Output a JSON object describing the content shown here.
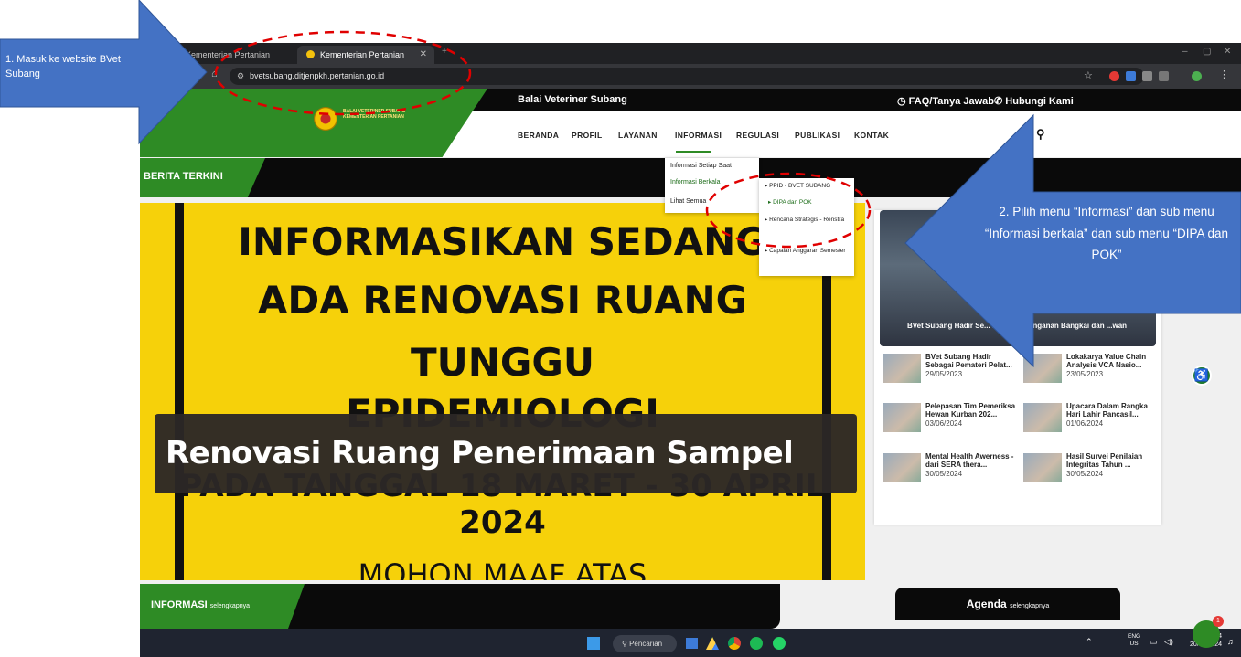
{
  "browser": {
    "tabs": [
      {
        "label": "Kementerian Pertanian"
      },
      {
        "label": "Kementerian Pertanian"
      }
    ],
    "url": "bvetsubang.ditjenpkh.pertanian.go.id"
  },
  "site": {
    "topbar": {
      "title": "Balai Veteriner Subang",
      "faq": "FAQ/Tanya Jawab",
      "contact": "Hubungi Kami"
    },
    "logo_text": "BALAI VETERINER SUBANG",
    "logo_sub": "KEMENTERIAN PERTANIAN",
    "nav": [
      "BERANDA",
      "PROFIL",
      "LAYANAN",
      "INFORMASI",
      "REGULASI",
      "PUBLIKASI",
      "KONTAK"
    ],
    "berita_label": "BERITA TERKINI",
    "dropdown": [
      "Informasi Setiap Saat",
      "Informasi Berkala",
      "Lihat Semua"
    ],
    "subdropdown": [
      "PPID - BVET SUBANG",
      "DIPA dan POK",
      "Rencana Strategis - Renstra",
      "Capaian Anggaran Semester"
    ],
    "banner": {
      "lines": [
        "INFORMASIKAN SEDANG",
        "ADA RENOVASI RUANG",
        "TUNGGU",
        "EPIDEMIOLOGI",
        "PADA TANGGAL 18 MARET - 30 APRIL",
        "2024",
        "MOHON MAAF ATAS"
      ],
      "caption": "Renovasi Ruang Penerimaan Sampel"
    },
    "feature_caption": "BVet Subang Hadir Se... ...ihan Penanganan Bangkai dan ...wan",
    "news": [
      {
        "title": "BVet Subang Hadir Sebagai Pemateri Pelat...",
        "date": "29/05/2023"
      },
      {
        "title": "Lokakarya Value Chain Analysis VCA Nasio...",
        "date": "23/05/2023"
      },
      {
        "title": "Pelepasan Tim Pemeriksa Hewan Kurban 202...",
        "date": "03/06/2024"
      },
      {
        "title": "Upacara Dalam Rangka Hari Lahir Pancasil...",
        "date": "01/06/2024"
      },
      {
        "title": "Mental Health Awerness - dari SERA thera...",
        "date": "30/05/2024"
      },
      {
        "title": "Hasil Survei Penilaian Integritas Tahun ...",
        "date": "30/05/2024"
      }
    ],
    "informasi": {
      "label": "INFORMASI",
      "more": "selengkapnya"
    },
    "agenda": {
      "label": "Agenda",
      "more": "selengkapnya"
    }
  },
  "callouts": {
    "step1": "1. Masuk ke website BVet Subang",
    "step2": "2. Pilih menu “Informasi” dan sub menu “Informasi berkala” dan sub menu “DIPA dan POK”"
  },
  "taskbar": {
    "search": "Pencarian",
    "lang": "ENG",
    "region": "US",
    "time": "11.24",
    "date": "20/07/2024"
  },
  "colors": {
    "brand_green": "#2e8b25",
    "banner_yellow": "#f6d10a",
    "callout_blue": "#4472c4",
    "annotation_red": "#e00000"
  }
}
